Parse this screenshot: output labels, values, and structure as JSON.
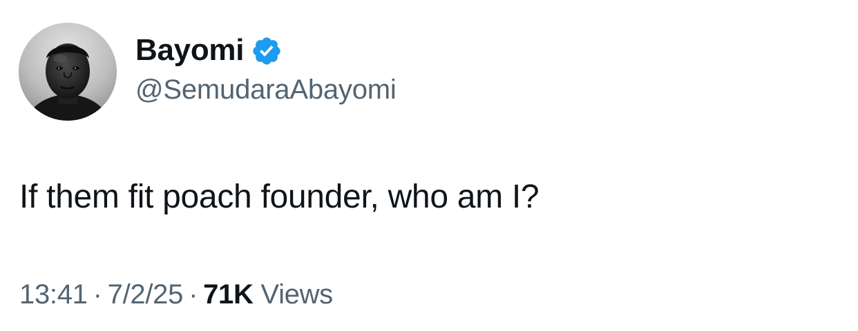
{
  "author": {
    "display_name": "Bayomi",
    "handle": "@SemudaraAbayomi",
    "verified": true,
    "verified_icon": "verified-badge-icon",
    "avatar_icon": "user-avatar"
  },
  "tweet": {
    "text": "If them fit poach founder, who am I?"
  },
  "meta": {
    "time": "13:41",
    "separator": "·",
    "date": "7/2/25",
    "views_count": "71K",
    "views_label": "Views"
  },
  "colors": {
    "primary_text": "#0f1419",
    "secondary_text": "#536471",
    "verified_blue": "#1d9bf0",
    "background": "#ffffff"
  }
}
